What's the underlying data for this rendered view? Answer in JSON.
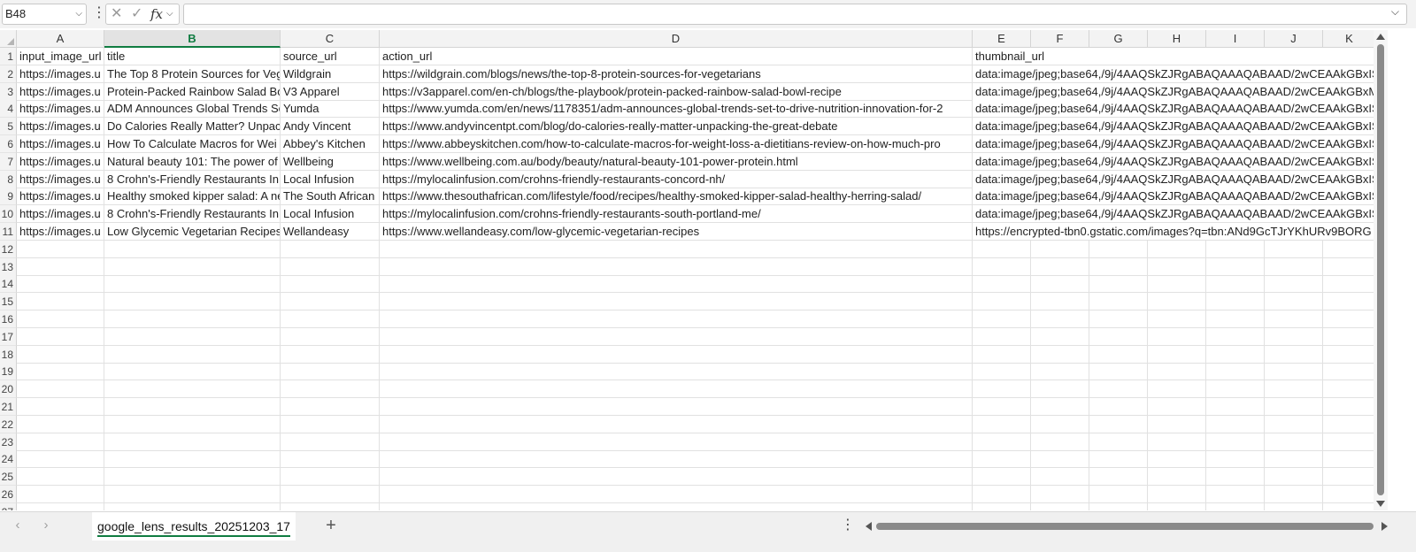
{
  "formula_bar": {
    "name_box": "B48",
    "cancel_icon": "✕",
    "enter_icon": "✓",
    "fx_label": "fx",
    "formula_value": ""
  },
  "columns": [
    {
      "letter": "A",
      "selected": false
    },
    {
      "letter": "B",
      "selected": true
    },
    {
      "letter": "C",
      "selected": false
    },
    {
      "letter": "D",
      "selected": false
    },
    {
      "letter": "E",
      "selected": false
    },
    {
      "letter": "F",
      "selected": false
    },
    {
      "letter": "G",
      "selected": false
    },
    {
      "letter": "H",
      "selected": false
    },
    {
      "letter": "I",
      "selected": false
    },
    {
      "letter": "J",
      "selected": false
    },
    {
      "letter": "K",
      "selected": false
    }
  ],
  "row_numbers": [
    "1",
    "2",
    "3",
    "4",
    "5",
    "6",
    "7",
    "8",
    "9",
    "10",
    "11",
    "12",
    "13",
    "14",
    "15",
    "16",
    "17",
    "18",
    "19",
    "20",
    "21",
    "22",
    "23",
    "24",
    "25",
    "26",
    "27"
  ],
  "rows": [
    [
      "input_image_url",
      "title",
      "source_url",
      "action_url",
      "thumbnail_url"
    ],
    [
      "https://images.u",
      "The Top 8 Protein Sources for Veg",
      "Wildgrain",
      "https://wildgrain.com/blogs/news/the-top-8-protein-sources-for-vegetarians",
      "data:image/jpeg;base64,/9j/4AAQSkZJRgABAQAAAQABAAD/2wCEAAkGBxIS"
    ],
    [
      "https://images.u",
      "Protein-Packed Rainbow Salad Bo",
      "V3 Apparel",
      "https://v3apparel.com/en-ch/blogs/the-playbook/protein-packed-rainbow-salad-bowl-recipe",
      "data:image/jpeg;base64,/9j/4AAQSkZJRgABAQAAAQABAAD/2wCEAAkGBxM"
    ],
    [
      "https://images.u",
      "ADM Announces Global Trends Se",
      "Yumda",
      "https://www.yumda.com/en/news/1178351/adm-announces-global-trends-set-to-drive-nutrition-innovation-for-2",
      "data:image/jpeg;base64,/9j/4AAQSkZJRgABAQAAAQABAAD/2wCEAAkGBxIS"
    ],
    [
      "https://images.u",
      "Do Calories Really Matter? Unpac",
      "Andy Vincent",
      "https://www.andyvincentpt.com/blog/do-calories-really-matter-unpacking-the-great-debate",
      "data:image/jpeg;base64,/9j/4AAQSkZJRgABAQAAAQABAAD/2wCEAAkGBxIS"
    ],
    [
      "https://images.u",
      "How To Calculate Macros for Wei",
      "Abbey's Kitchen",
      "https://www.abbeyskitchen.com/how-to-calculate-macros-for-weight-loss-a-dietitians-review-on-how-much-pro",
      "data:image/jpeg;base64,/9j/4AAQSkZJRgABAQAAAQABAAD/2wCEAAkGBxIS"
    ],
    [
      "https://images.u",
      "Natural beauty 101: The power of",
      "Wellbeing",
      "https://www.wellbeing.com.au/body/beauty/natural-beauty-101-power-protein.html",
      "data:image/jpeg;base64,/9j/4AAQSkZJRgABAQAAAQABAAD/2wCEAAkGBxIS"
    ],
    [
      "https://images.u",
      "8 Crohn's-Friendly Restaurants In",
      "Local Infusion",
      "https://mylocalinfusion.com/crohns-friendly-restaurants-concord-nh/",
      "data:image/jpeg;base64,/9j/4AAQSkZJRgABAQAAAQABAAD/2wCEAAkGBxIS"
    ],
    [
      "https://images.u",
      "Healthy smoked kipper salad: A ne",
      "The South African",
      "https://www.thesouthafrican.com/lifestyle/food/recipes/healthy-smoked-kipper-salad-healthy-herring-salad/",
      "data:image/jpeg;base64,/9j/4AAQSkZJRgABAQAAAQABAAD/2wCEAAkGBxIS"
    ],
    [
      "https://images.u",
      "8 Crohn's-Friendly Restaurants In",
      "Local Infusion",
      "https://mylocalinfusion.com/crohns-friendly-restaurants-south-portland-me/",
      "data:image/jpeg;base64,/9j/4AAQSkZJRgABAQAAAQABAAD/2wCEAAkGBxIS"
    ],
    [
      "https://images.u",
      "Low Glycemic Vegetarian Recipes",
      "Wellandeasy",
      "https://www.wellandeasy.com/low-glycemic-vegetarian-recipes",
      "https://encrypted-tbn0.gstatic.com/images?q=tbn:ANd9GcTJrYKhURv9BORG"
    ]
  ],
  "sheet_tab": "google_lens_results_20251203_17",
  "add_sheet_label": "+",
  "nav_prev": "‹",
  "nav_next": "›",
  "more_options": "⋮"
}
